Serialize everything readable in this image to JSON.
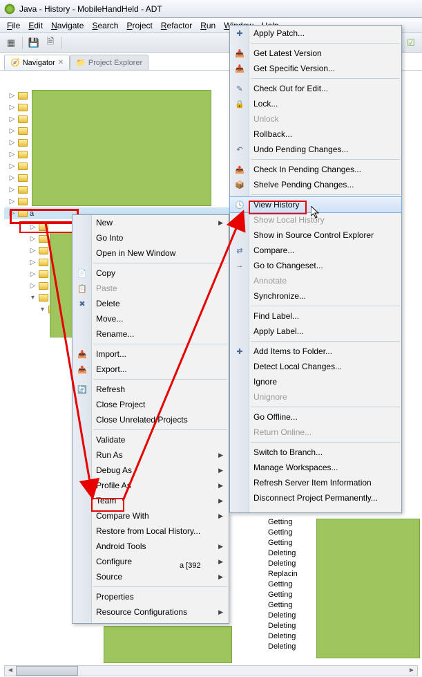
{
  "title": "Java - History - MobileHandHeld - ADT",
  "menubar": [
    "File",
    "Edit",
    "Navigate",
    "Search",
    "Project",
    "Refactor",
    "Run",
    "Window",
    "Help"
  ],
  "viewtabs": {
    "active": "Navigator",
    "inactive": "Project Explorer"
  },
  "context1": {
    "items": [
      {
        "label": "New",
        "sub": true
      },
      {
        "label": "Go Into"
      },
      {
        "label": "Open in New Window"
      },
      {
        "sep": true
      },
      {
        "label": "Copy",
        "icon": "📄"
      },
      {
        "label": "Paste",
        "icon": "📋",
        "disabled": true
      },
      {
        "label": "Delete",
        "icon": "✖"
      },
      {
        "label": "Move..."
      },
      {
        "label": "Rename..."
      },
      {
        "sep": true
      },
      {
        "label": "Import...",
        "icon": "📥"
      },
      {
        "label": "Export...",
        "icon": "📤"
      },
      {
        "sep": true
      },
      {
        "label": "Refresh",
        "icon": "🔄"
      },
      {
        "label": "Close Project"
      },
      {
        "label": "Close Unrelated Projects"
      },
      {
        "sep": true
      },
      {
        "label": "Validate"
      },
      {
        "label": "Run As",
        "sub": true
      },
      {
        "label": "Debug As",
        "sub": true
      },
      {
        "label": "Profile As",
        "sub": true
      },
      {
        "label": "Team",
        "sub": true,
        "boxed": true
      },
      {
        "label": "Compare With",
        "sub": true
      },
      {
        "label": "Restore from Local History..."
      },
      {
        "label": "Android Tools",
        "sub": true
      },
      {
        "label": "Configure",
        "sub": true
      },
      {
        "label": "Source",
        "sub": true
      },
      {
        "sep": true
      },
      {
        "label": "Properties"
      },
      {
        "label": "Resource Configurations",
        "sub": true
      }
    ]
  },
  "context2": {
    "items": [
      {
        "label": "Apply Patch...",
        "icon": "✚"
      },
      {
        "sep": true
      },
      {
        "label": "Get Latest Version",
        "icon": "📥"
      },
      {
        "label": "Get Specific Version...",
        "icon": "📥"
      },
      {
        "sep": true
      },
      {
        "label": "Check Out for Edit...",
        "icon": "✎"
      },
      {
        "label": "Lock...",
        "icon": "🔒"
      },
      {
        "label": "Unlock",
        "disabled": true
      },
      {
        "label": "Rollback..."
      },
      {
        "label": "Undo Pending Changes...",
        "icon": "↶"
      },
      {
        "sep": true
      },
      {
        "label": "Check In Pending Changes...",
        "icon": "📤"
      },
      {
        "label": "Shelve Pending Changes...",
        "icon": "📦"
      },
      {
        "sep": true
      },
      {
        "label": "View History",
        "highlight": true,
        "boxed": true,
        "icon": "🕓"
      },
      {
        "label": "Show Local History",
        "disabled": true
      },
      {
        "label": "Show in Source Control Explorer"
      },
      {
        "label": "Compare...",
        "icon": "⇄"
      },
      {
        "label": "Go to Changeset...",
        "icon": "→"
      },
      {
        "label": "Annotate",
        "disabled": true
      },
      {
        "label": "Synchronize..."
      },
      {
        "sep": true
      },
      {
        "label": "Find Label..."
      },
      {
        "label": "Apply Label..."
      },
      {
        "sep": true
      },
      {
        "label": "Add Items to Folder...",
        "icon": "✚"
      },
      {
        "label": "Detect Local Changes..."
      },
      {
        "label": "Ignore"
      },
      {
        "label": "Unignore",
        "disabled": true
      },
      {
        "sep": true
      },
      {
        "label": "Go Offline..."
      },
      {
        "label": "Return Online...",
        "disabled": true
      },
      {
        "sep": true
      },
      {
        "label": "Switch to Branch..."
      },
      {
        "label": "Manage Workspaces..."
      },
      {
        "label": "Refresh Server Item Information"
      },
      {
        "label": "Disconnect Project Permanently..."
      }
    ]
  },
  "console": [
    "Getting",
    "Getting",
    "Getting",
    "Deleting",
    "Deleting",
    "Replacin",
    "Getting",
    "Getting",
    "Getting",
    "Deleting",
    "Deleting",
    "Deleting",
    "Deleting"
  ],
  "rowtext": "a",
  "snippet": "a [392"
}
